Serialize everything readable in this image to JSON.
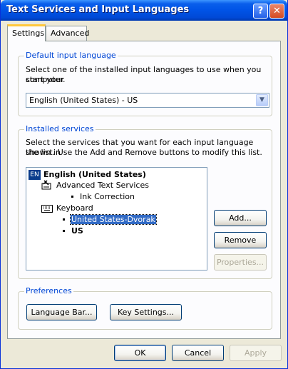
{
  "window": {
    "title": "Text Services and Input Languages"
  },
  "tabs": [
    {
      "label": "Settings"
    },
    {
      "label": "Advanced"
    }
  ],
  "default_language": {
    "group_label": "Default input language",
    "description_line1": "Select one of the installed input languages to use when you start your",
    "description_line2": "computer.",
    "selected_value": "English (United States) - US"
  },
  "installed_services": {
    "group_label": "Installed services",
    "description_line1": "Select the services that you want for each input language shown in",
    "description_line2": "the list. Use the Add and Remove buttons to modify this list.",
    "tree": {
      "language_badge": "EN",
      "language": "English (United States)",
      "advanced_text_services": "Advanced Text Services",
      "ink_correction": "Ink Correction",
      "keyboard": "Keyboard",
      "layout_selected": "United States-Dvorak",
      "layout_us": "US"
    },
    "add_label": "Add...",
    "remove_label": "Remove",
    "properties_label": "Properties..."
  },
  "preferences": {
    "group_label": "Preferences",
    "language_bar_label": "Language Bar...",
    "key_settings_label": "Key Settings..."
  },
  "footer": {
    "ok_label": "OK",
    "cancel_label": "Cancel",
    "apply_label": "Apply"
  }
}
